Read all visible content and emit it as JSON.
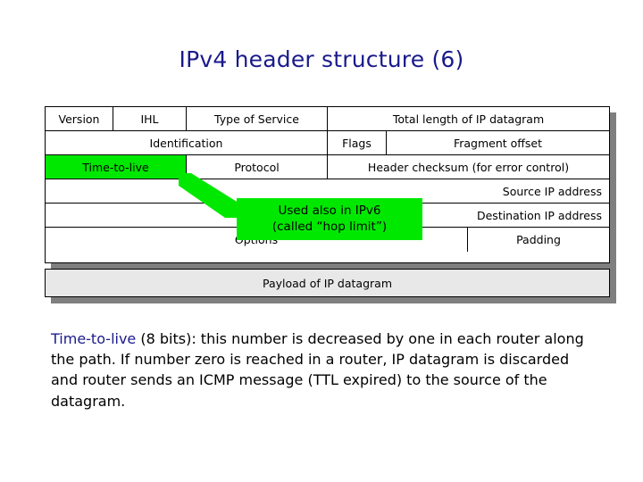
{
  "slide": {
    "title": "IPv4 header structure (6)"
  },
  "header_table": {
    "rows": [
      {
        "cells": [
          {
            "label": "Version"
          },
          {
            "label": "IHL"
          },
          {
            "label": "Type of Service"
          },
          {
            "label": "Total length of IP datagram"
          }
        ]
      },
      {
        "cells": [
          {
            "label": "Identification"
          },
          {
            "label": "Flags"
          },
          {
            "label": "Fragment offset"
          }
        ]
      },
      {
        "cells": [
          {
            "label": "Time-to-live"
          },
          {
            "label": "Protocol"
          },
          {
            "label": "Header checksum (for error control)"
          }
        ]
      },
      {
        "cells": [
          {
            "label": "Source IP address"
          }
        ]
      },
      {
        "cells": [
          {
            "label": "Destination IP address"
          }
        ]
      },
      {
        "cells": [
          {
            "label": "Options"
          },
          {
            "label": "Padding"
          }
        ]
      }
    ],
    "payload_label": "Payload of IP datagram"
  },
  "callout": {
    "line1": "Used also in IPv6",
    "line2": "(called “hop limit”)"
  },
  "note": {
    "term": "Time-to-live",
    "body": " (8 bits): this number is decreased by one in each router along the path. If number zero is reached in a router, IP datagram is discarded and router sends an ICMP message (TTL expired) to the source of the datagram."
  },
  "colors": {
    "title_blue": "#1a1a8c",
    "highlight_green": "#00e800",
    "payload_gray": "#e8e8e8",
    "shadow_gray": "#7f7f7f"
  }
}
